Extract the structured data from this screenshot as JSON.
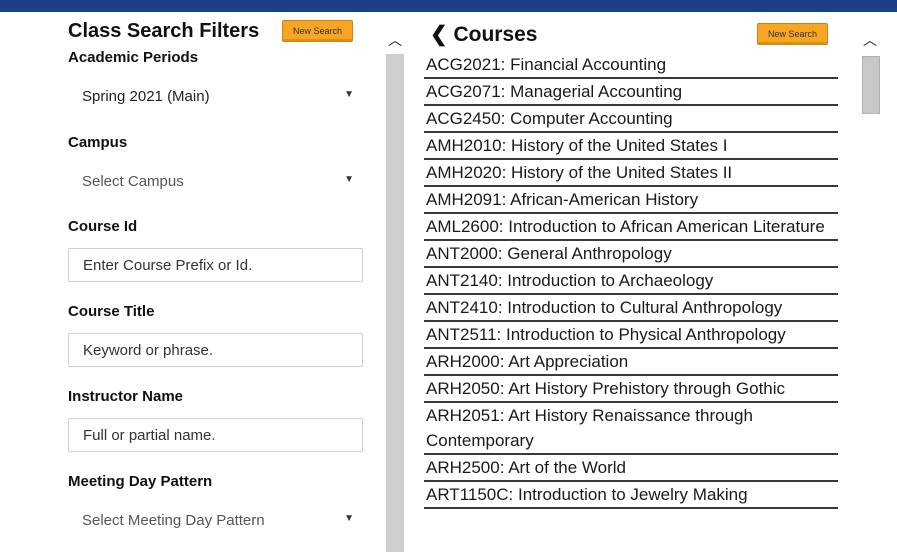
{
  "filters": {
    "title": "Class Search Filters",
    "new_search_label": "New Search",
    "academic_periods": {
      "label": "Academic Periods",
      "value": "Spring 2021 (Main)"
    },
    "campus": {
      "label": "Campus",
      "placeholder": "Select Campus"
    },
    "course_id": {
      "label": "Course Id",
      "placeholder": "Enter Course Prefix or Id."
    },
    "course_title": {
      "label": "Course Title",
      "placeholder": "Keyword or phrase."
    },
    "instructor_name": {
      "label": "Instructor Name",
      "placeholder": "Full or partial name."
    },
    "meeting_day_pattern": {
      "label": "Meeting Day Pattern",
      "placeholder": "Select Meeting Day Pattern"
    }
  },
  "courses": {
    "title": "Courses",
    "new_search_label": "New Search",
    "items": [
      "ACG2021: Financial Accounting",
      "ACG2071: Managerial Accounting",
      "ACG2450: Computer Accounting",
      "AMH2010: History of the United States I",
      "AMH2020: History of the United States II",
      "AMH2091: African-American History",
      "AML2600: Introduction to African American Literature",
      "ANT2000: General Anthropology",
      "ANT2140: Introduction to Archaeology",
      "ANT2410: Introduction to Cultural Anthropology",
      "ANT2511: Introduction to Physical Anthropology",
      "ARH2000: Art Appreciation",
      "ARH2050: Art History Prehistory through Gothic",
      "ARH2051: Art History Renaissance through Contemporary",
      "ARH2500: Art of the World",
      "ART1150C: Introduction to Jewelry Making"
    ]
  },
  "colors": {
    "accent": "#f7a623",
    "topbar": "#1d3f8a",
    "scroll_track": "#cfcfcf"
  },
  "icons": {
    "back": "chevron-left-icon",
    "scroll_up": "chevron-up-icon",
    "dropdown": "caret-down-icon"
  }
}
